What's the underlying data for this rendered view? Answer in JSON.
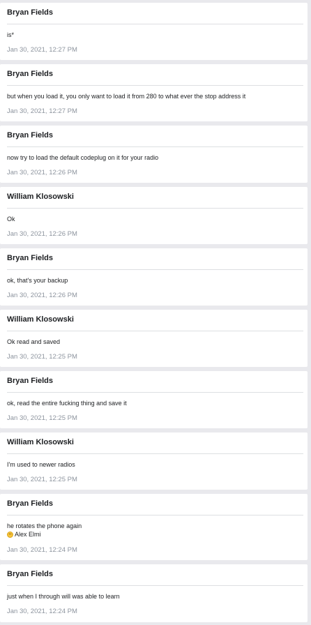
{
  "messages": [
    {
      "author": "Bryan Fields",
      "lines": [
        "is*"
      ],
      "time": "Jan 30, 2021, 12:27 PM"
    },
    {
      "author": "Bryan Fields",
      "lines": [
        "but when you load it, you only want to load it from 280 to what ever the stop address it"
      ],
      "time": "Jan 30, 2021, 12:27 PM"
    },
    {
      "author": "Bryan Fields",
      "lines": [
        "now try to load the default codeplug on it for your radio"
      ],
      "time": "Jan 30, 2021, 12:26 PM"
    },
    {
      "author": "William Klosowski",
      "lines": [
        "Ok"
      ],
      "time": "Jan 30, 2021, 12:26 PM"
    },
    {
      "author": "Bryan Fields",
      "lines": [
        "ok, that's your backup"
      ],
      "time": "Jan 30, 2021, 12:26 PM"
    },
    {
      "author": "William Klosowski",
      "lines": [
        "Ok read and saved"
      ],
      "time": "Jan 30, 2021, 12:25 PM"
    },
    {
      "author": "Bryan Fields",
      "lines": [
        "ok, read the entire fucking thing and save it"
      ],
      "time": "Jan 30, 2021, 12:25 PM"
    },
    {
      "author": "William Klosowski",
      "lines": [
        "I'm used to newer radios"
      ],
      "time": "Jan 30, 2021, 12:25 PM"
    },
    {
      "author": "Bryan Fields",
      "lines": [
        "he rotates the phone again"
      ],
      "reaction": {
        "icon": "smiley-emoji-icon",
        "name": "Alex Elmi"
      },
      "time": "Jan 30, 2021, 12:24 PM"
    },
    {
      "author": "Bryan Fields",
      "lines": [
        "just when I through will was able to learn"
      ],
      "time": "Jan 30, 2021, 12:24 PM"
    }
  ]
}
